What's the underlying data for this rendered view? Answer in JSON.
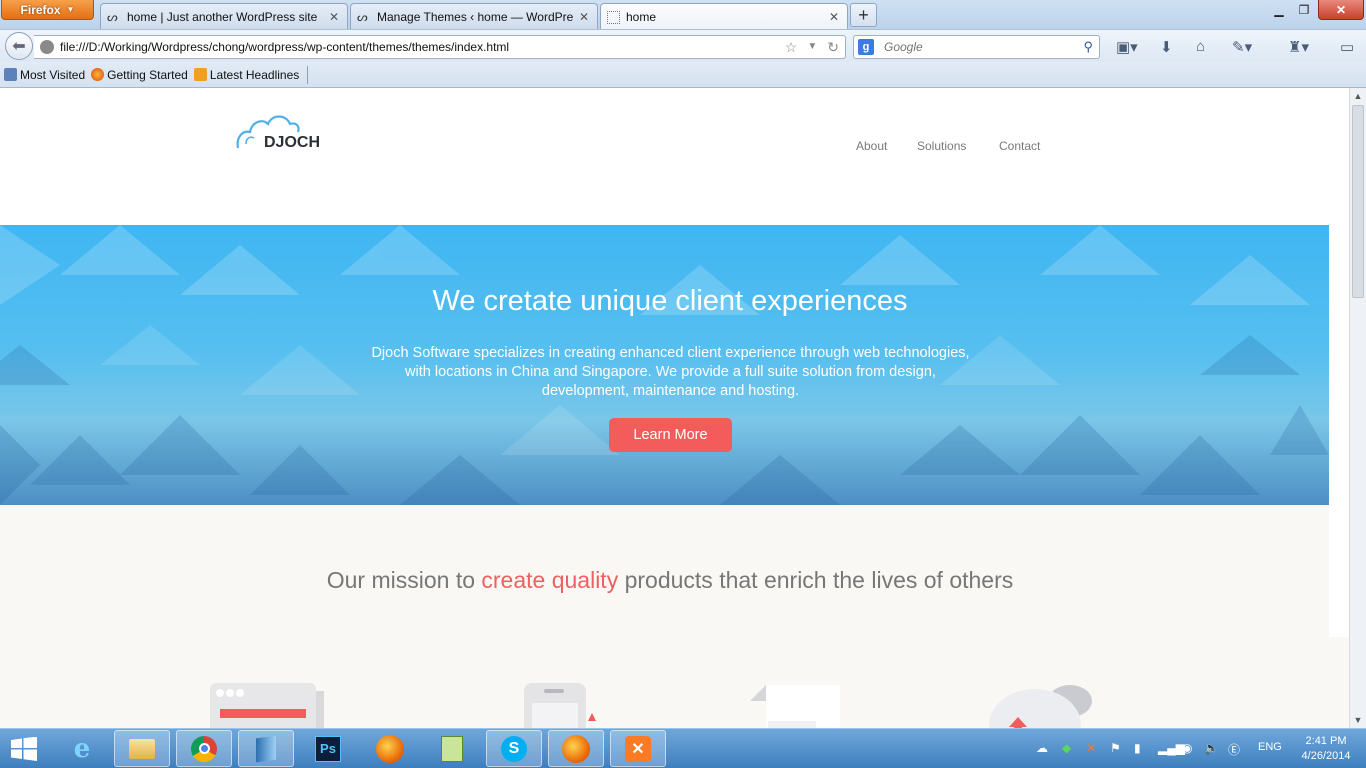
{
  "browser": {
    "menu_button": "Firefox",
    "tabs": [
      {
        "label": "home | Just another WordPress site"
      },
      {
        "label": "Manage Themes ‹ home — WordPress"
      },
      {
        "label": "home"
      }
    ],
    "url": "file:///D:/Working/Wordpress/chong/wordpress/wp-content/themes/themes/index.html",
    "search_placeholder": "Google",
    "bookmarks": [
      "Most Visited",
      "Getting Started",
      "Latest Headlines"
    ]
  },
  "site": {
    "logo_text": "DJOCH",
    "nav": [
      "About",
      "Solutions",
      "Contact"
    ],
    "hero": {
      "title": "We cretate unique client experiences",
      "text": "Djoch Software specializes in creating enhanced client experience through web technologies, with locations in China and Singapore. We provide a full suite solution from design, development, maintenance and hosting.",
      "button": "Learn More"
    },
    "mission": {
      "before": "Our mission to ",
      "highlight": "create quality",
      "after": " products that enrich the lives of others"
    }
  },
  "taskbar": {
    "language": "ENG",
    "time": "2:41 PM",
    "date": "4/26/2014"
  },
  "colors": {
    "accent": "#f45b5b",
    "hero_blue": "#3fb6f2",
    "taskbar": "#3f7fbf"
  }
}
